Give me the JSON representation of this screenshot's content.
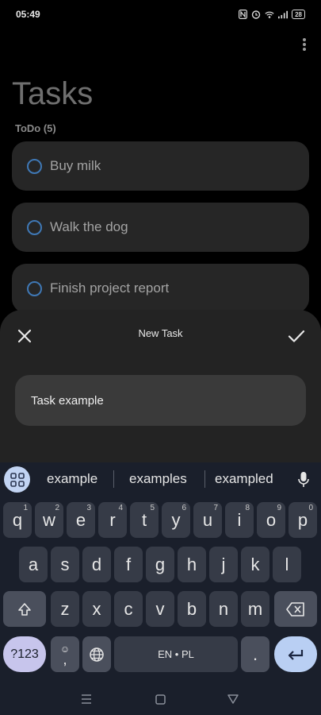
{
  "status_bar": {
    "time": "05:49",
    "battery": "28"
  },
  "app": {
    "title": "Tasks",
    "section": "ToDo (5)"
  },
  "tasks": [
    {
      "label": "Buy milk"
    },
    {
      "label": "Walk the dog"
    },
    {
      "label": "Finish project report"
    }
  ],
  "sheet": {
    "title": "New Task",
    "input_value": "Task example"
  },
  "keyboard": {
    "suggestions": [
      "example",
      "examples",
      "exampled"
    ],
    "row1": [
      {
        "k": "q",
        "h": "1"
      },
      {
        "k": "w",
        "h": "2"
      },
      {
        "k": "e",
        "h": "3"
      },
      {
        "k": "r",
        "h": "4"
      },
      {
        "k": "t",
        "h": "5"
      },
      {
        "k": "y",
        "h": "6"
      },
      {
        "k": "u",
        "h": "7"
      },
      {
        "k": "i",
        "h": "8"
      },
      {
        "k": "o",
        "h": "9"
      },
      {
        "k": "p",
        "h": "0"
      }
    ],
    "row2": [
      "a",
      "s",
      "d",
      "f",
      "g",
      "h",
      "j",
      "k",
      "l"
    ],
    "row3": [
      "z",
      "x",
      "c",
      "v",
      "b",
      "n",
      "m"
    ],
    "symbols_label": "?123",
    "emoji_comma_label": ",",
    "space_label": "EN • PL",
    "period_label": ".",
    "colors": {
      "accent": "#c2d4f3",
      "key": "#363b47",
      "background": "#1a1f2b"
    }
  },
  "icons": {
    "status": [
      "nfc-icon",
      "alarm-icon",
      "wifi-icon",
      "signal-icon",
      "battery-icon"
    ],
    "sheet": [
      "close-icon",
      "check-icon"
    ],
    "keyboard": [
      "apps-grid-icon",
      "mic-icon",
      "shift-icon",
      "backspace-icon",
      "emoji-icon",
      "globe-icon",
      "enter-icon"
    ],
    "nav": [
      "menu-icon",
      "home-icon",
      "back-icon"
    ]
  }
}
